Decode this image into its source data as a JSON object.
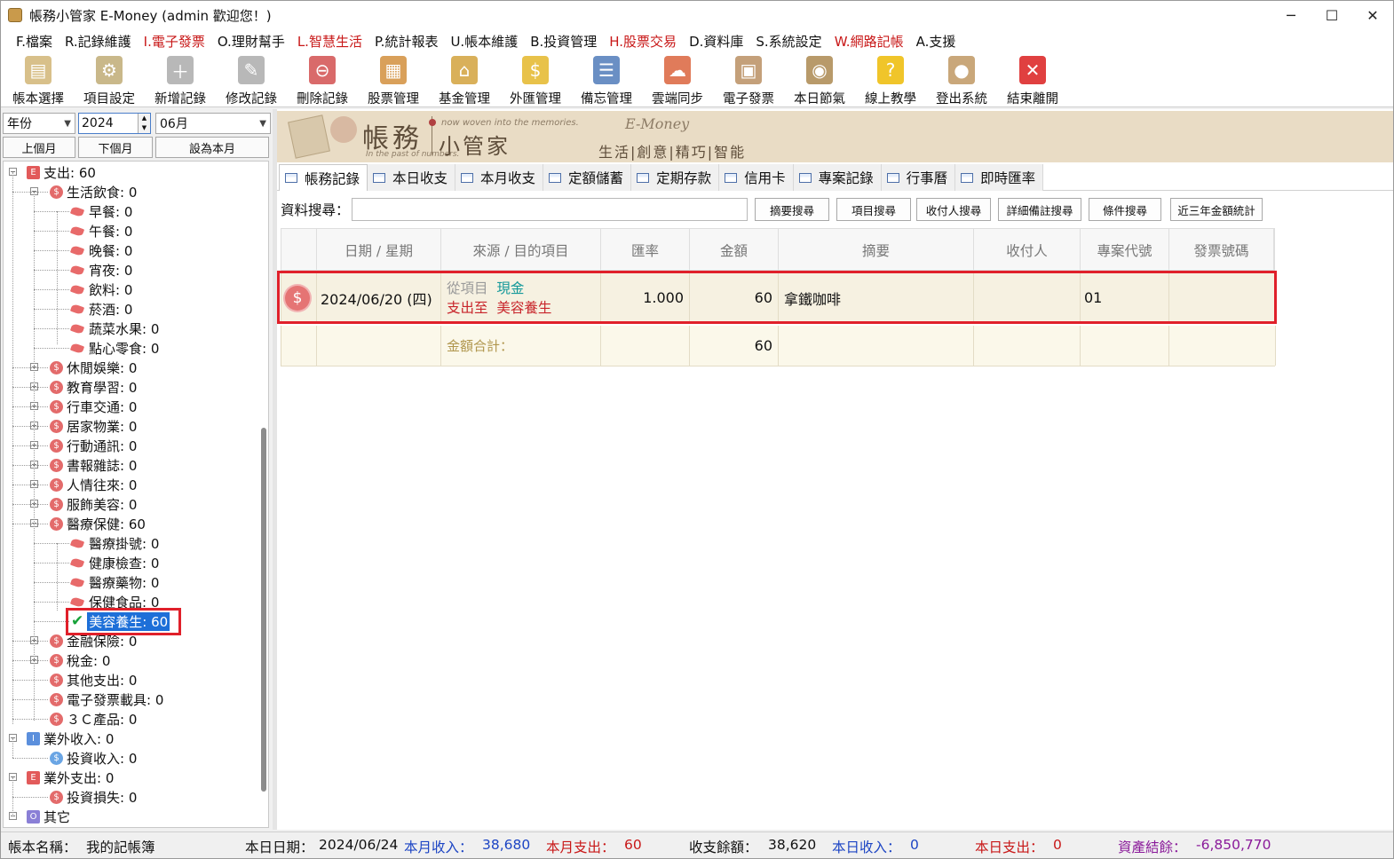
{
  "window": {
    "title": "帳務小管家 E-Money (admin 歡迎您！)",
    "controls": [
      "minimize-icon",
      "maximize-icon",
      "close-icon"
    ]
  },
  "menu": [
    {
      "label": "F.檔案",
      "red": false
    },
    {
      "label": "R.記錄維護",
      "red": false
    },
    {
      "label": "I.電子發票",
      "red": true
    },
    {
      "label": "O.理財幫手",
      "red": false
    },
    {
      "label": "L.智慧生活",
      "red": true
    },
    {
      "label": "P.統計報表",
      "red": false
    },
    {
      "label": "U.帳本維護",
      "red": false
    },
    {
      "label": "B.投資管理",
      "red": false
    },
    {
      "label": "H.股票交易",
      "red": true
    },
    {
      "label": "D.資料庫",
      "red": false
    },
    {
      "label": "S.系統設定",
      "red": false
    },
    {
      "label": "W.網路記帳",
      "red": true
    },
    {
      "label": "A.支援",
      "red": false
    }
  ],
  "toolbar": [
    {
      "label": "帳本選擇",
      "icon": "ledger-icon",
      "color": "#d8c08a"
    },
    {
      "label": "項目設定",
      "icon": "settings-icon",
      "color": "#c9b88a"
    },
    {
      "label": "新增記錄",
      "icon": "add-record-icon",
      "color": "#b8b8b8"
    },
    {
      "label": "修改記錄",
      "icon": "edit-record-icon",
      "color": "#b8b8b8"
    },
    {
      "label": "刪除記錄",
      "icon": "delete-record-icon",
      "color": "#d96a6a"
    },
    {
      "label": "股票管理",
      "icon": "stock-icon",
      "color": "#d9a05a"
    },
    {
      "label": "基金管理",
      "icon": "fund-icon",
      "color": "#d9b05a"
    },
    {
      "label": "外匯管理",
      "icon": "forex-icon",
      "color": "#e8c24a"
    },
    {
      "label": "備忘管理",
      "icon": "memo-icon",
      "color": "#6a8fc4"
    },
    {
      "label": "雲端同步",
      "icon": "cloud-sync-icon",
      "color": "#e07b5a"
    },
    {
      "label": "電子發票",
      "icon": "qr-invoice-icon",
      "color": "#c4a07a"
    },
    {
      "label": "本日節氣",
      "icon": "solar-term-icon",
      "color": "#b89a6a"
    },
    {
      "label": "線上教學",
      "icon": "help-icon",
      "color": "#f0c52a"
    },
    {
      "label": "登出系統",
      "icon": "logout-icon",
      "color": "#c9a77a"
    },
    {
      "label": "結束離開",
      "icon": "exit-icon",
      "color": "#e04040"
    }
  ],
  "filters": {
    "period_type": "年份",
    "year": "2024",
    "month": "06月",
    "prev_month": "上個月",
    "next_month": "下個月",
    "set_this_month": "設為本月"
  },
  "tree": [
    {
      "label": "支出: 60",
      "type": "E",
      "level": 0,
      "exp": "-"
    },
    {
      "label": "生活飲食: 0",
      "type": "S",
      "level": 1,
      "exp": "-"
    },
    {
      "label": "早餐: 0",
      "type": "leaf",
      "level": 2
    },
    {
      "label": "午餐: 0",
      "type": "leaf",
      "level": 2
    },
    {
      "label": "晚餐: 0",
      "type": "leaf",
      "level": 2
    },
    {
      "label": "宵夜: 0",
      "type": "leaf",
      "level": 2
    },
    {
      "label": "飲料: 0",
      "type": "leaf",
      "level": 2
    },
    {
      "label": "菸酒: 0",
      "type": "leaf",
      "level": 2
    },
    {
      "label": "蔬菜水果: 0",
      "type": "leaf",
      "level": 2
    },
    {
      "label": "點心零食: 0",
      "type": "leaf",
      "level": 2
    },
    {
      "label": "休閒娛樂: 0",
      "type": "S",
      "level": 1,
      "exp": "+"
    },
    {
      "label": "教育學習: 0",
      "type": "S",
      "level": 1,
      "exp": "+"
    },
    {
      "label": "行車交通: 0",
      "type": "S",
      "level": 1,
      "exp": "+"
    },
    {
      "label": "居家物業: 0",
      "type": "S",
      "level": 1,
      "exp": "+"
    },
    {
      "label": "行動通訊: 0",
      "type": "S",
      "level": 1,
      "exp": "+"
    },
    {
      "label": "書報雜誌: 0",
      "type": "S",
      "level": 1,
      "exp": "+"
    },
    {
      "label": "人情往來: 0",
      "type": "S",
      "level": 1,
      "exp": "+"
    },
    {
      "label": "服飾美容: 0",
      "type": "S",
      "level": 1,
      "exp": "+"
    },
    {
      "label": "醫療保健: 60",
      "type": "S",
      "level": 1,
      "exp": "-"
    },
    {
      "label": "醫療掛號: 0",
      "type": "leaf",
      "level": 2
    },
    {
      "label": "健康檢查: 0",
      "type": "leaf",
      "level": 2
    },
    {
      "label": "醫療藥物: 0",
      "type": "leaf",
      "level": 2
    },
    {
      "label": "保健食品: 0",
      "type": "leaf",
      "level": 2
    },
    {
      "label": "美容養生: 60",
      "type": "check",
      "level": 2,
      "selected": true
    },
    {
      "label": "金融保險: 0",
      "type": "S",
      "level": 1,
      "exp": "+"
    },
    {
      "label": "稅金: 0",
      "type": "S",
      "level": 1,
      "exp": "+"
    },
    {
      "label": "其他支出: 0",
      "type": "S",
      "level": 1
    },
    {
      "label": "電子發票載具: 0",
      "type": "S",
      "level": 1
    },
    {
      "label": "３Ｃ產品: 0",
      "type": "S",
      "level": 1
    },
    {
      "label": "業外收入: 0",
      "type": "I",
      "level": 0,
      "exp": "-"
    },
    {
      "label": "投資收入: 0",
      "type": "SB",
      "level": 1
    },
    {
      "label": "業外支出: 0",
      "type": "E",
      "level": 0,
      "exp": "-"
    },
    {
      "label": "投資損失: 0",
      "type": "S",
      "level": 1
    },
    {
      "label": "其它",
      "type": "O",
      "level": 0,
      "exp": "-"
    }
  ],
  "banner": {
    "title1": "帳務",
    "title2": "小管家",
    "tag1": "now woven into the memories.",
    "tag2": "In the past of numbers.",
    "brand": "E-Money",
    "slogan": "生活|創意|精巧|智能"
  },
  "tabs": [
    "帳務記錄",
    "本日收支",
    "本月收支",
    "定額儲蓄",
    "定期存款",
    "信用卡",
    "專案記錄",
    "行事曆",
    "即時匯率"
  ],
  "search": {
    "label": "資料搜尋：",
    "value": "",
    "buttons": [
      "摘要搜尋",
      "項目搜尋",
      "收付人搜尋",
      "詳細備註搜尋",
      "條件搜尋",
      "近三年金額統計"
    ]
  },
  "table": {
    "columns": [
      "",
      "日期 / 星期",
      "來源 / 目的項目",
      "匯率",
      "金額",
      "摘要",
      "收付人",
      "專案代號",
      "發票號碼"
    ],
    "row": {
      "date": "2024/06/20 (四)",
      "from_label": "從項目",
      "from_item": "現金",
      "to_label": "支出至",
      "to_item": "美容養生",
      "rate": "1.000",
      "amount": "60",
      "summary": "拿鐵咖啡",
      "payee": "",
      "project": "01",
      "invoice": ""
    },
    "total_label": "金額合計：",
    "total_amount": "60"
  },
  "status": {
    "ledger_label": "帳本名稱：",
    "ledger_name": "我的記帳簿",
    "today_label": "本日日期：",
    "today": "2024/06/24",
    "month_income_label": "本月收入：",
    "month_income": "38,680",
    "month_expense_label": "本月支出：",
    "month_expense": "60",
    "balance_label": "收支餘額：",
    "balance": "38,620",
    "day_income_label": "本日收入：",
    "day_income": "0",
    "day_expense_label": "本日支出：",
    "day_expense": "0",
    "assets_label": "資產結餘：",
    "assets": "-6,850,770"
  }
}
